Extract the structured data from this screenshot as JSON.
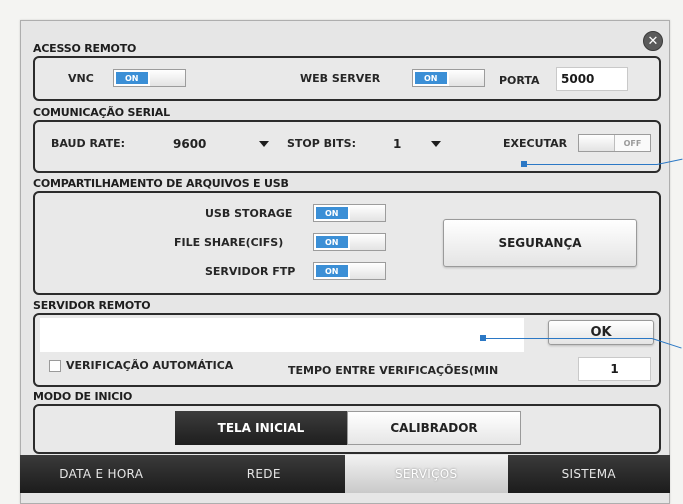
{
  "acesso_remoto": {
    "title": "ACESSO REMOTO",
    "vnc_label": "VNC",
    "vnc_toggle": "ON",
    "web_server_label": "WEB SERVER",
    "web_server_toggle": "ON",
    "porta_label": "PORTA",
    "porta_value": "5000"
  },
  "comunicacao_serial": {
    "title": "COMUNICAÇÃO SERIAL",
    "baud_rate_label": "BAUD RATE:",
    "baud_rate_value": "9600",
    "stop_bits_label": "STOP BITS:",
    "stop_bits_value": "1",
    "executar_label": "EXECUTAR",
    "executar_toggle": "OFF"
  },
  "compartilhamento": {
    "title": "COMPARTILHAMENTO DE ARQUIVOS E USB",
    "usb_storage_label": "USB STORAGE",
    "usb_storage_toggle": "ON",
    "file_share_label": "FILE SHARE(CIFS)",
    "file_share_toggle": "ON",
    "servidor_ftp_label": "SERVIDOR FTP",
    "servidor_ftp_toggle": "ON",
    "seguranca_button": "SEGURANÇA"
  },
  "servidor_remoto": {
    "title": "SERVIDOR REMOTO",
    "server_value": "",
    "ok_button": "OK",
    "verificacao_label": "VERIFICAÇÃO AUTOMÁTICA",
    "tempo_label": "TEMPO ENTRE VERIFICAÇÕES(MIN",
    "tempo_value": "1"
  },
  "modo_de_inicio": {
    "title": "MODO DE INICIO",
    "tela_inicial": "TELA INICIAL",
    "calibrador": "CALIBRADOR"
  },
  "tabs": [
    {
      "label": "DATA E HORA"
    },
    {
      "label": "REDE"
    },
    {
      "label": "SERVIÇOS"
    },
    {
      "label": "SISTEMA"
    }
  ],
  "colors": {
    "accent": "#3b8fd6",
    "tabbar": "#2a2a2a",
    "active_tab": "#dcdcdc"
  }
}
